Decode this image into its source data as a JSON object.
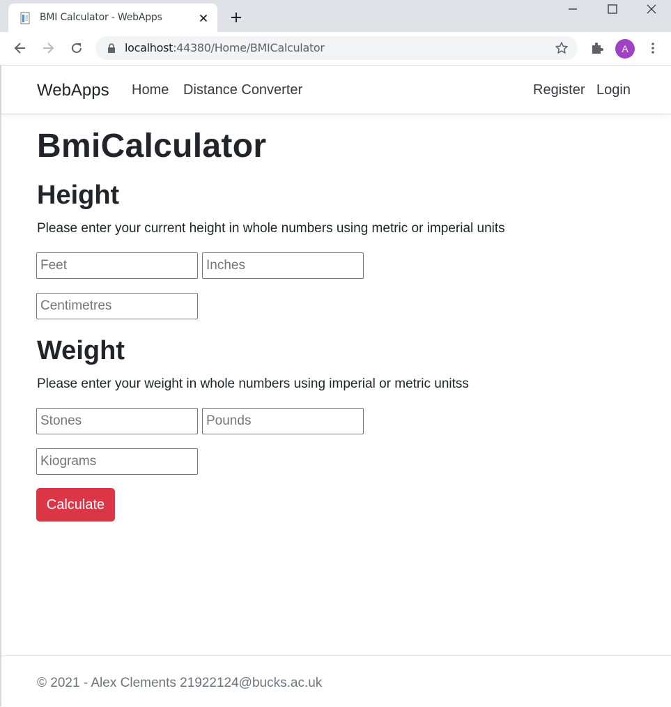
{
  "browser": {
    "tab_title": "BMI Calculator - WebApps",
    "url_host": "localhost",
    "url_path": ":44380/Home/BMICalculator",
    "profile_initial": "A",
    "profile_color": "#a142c5"
  },
  "navbar": {
    "brand": "WebApps",
    "links": [
      "Home",
      "Distance Converter"
    ],
    "right_links": [
      "Register",
      "Login"
    ]
  },
  "main": {
    "title": "BmiCalculator",
    "height": {
      "heading": "Height",
      "description": "Please enter your current height in whole numbers using metric or imperial units",
      "feet_placeholder": "Feet",
      "inches_placeholder": "Inches",
      "cm_placeholder": "Centimetres"
    },
    "weight": {
      "heading": "Weight",
      "description": "Please enter your weight in whole numbers using imperial or metric unitss",
      "stones_placeholder": "Stones",
      "pounds_placeholder": "Pounds",
      "kg_placeholder": "Kiograms"
    },
    "calculate_label": "Calculate",
    "button_color": "#dc3545"
  },
  "footer": {
    "text": "© 2021 - Alex Clements 21922124@bucks.ac.uk"
  }
}
